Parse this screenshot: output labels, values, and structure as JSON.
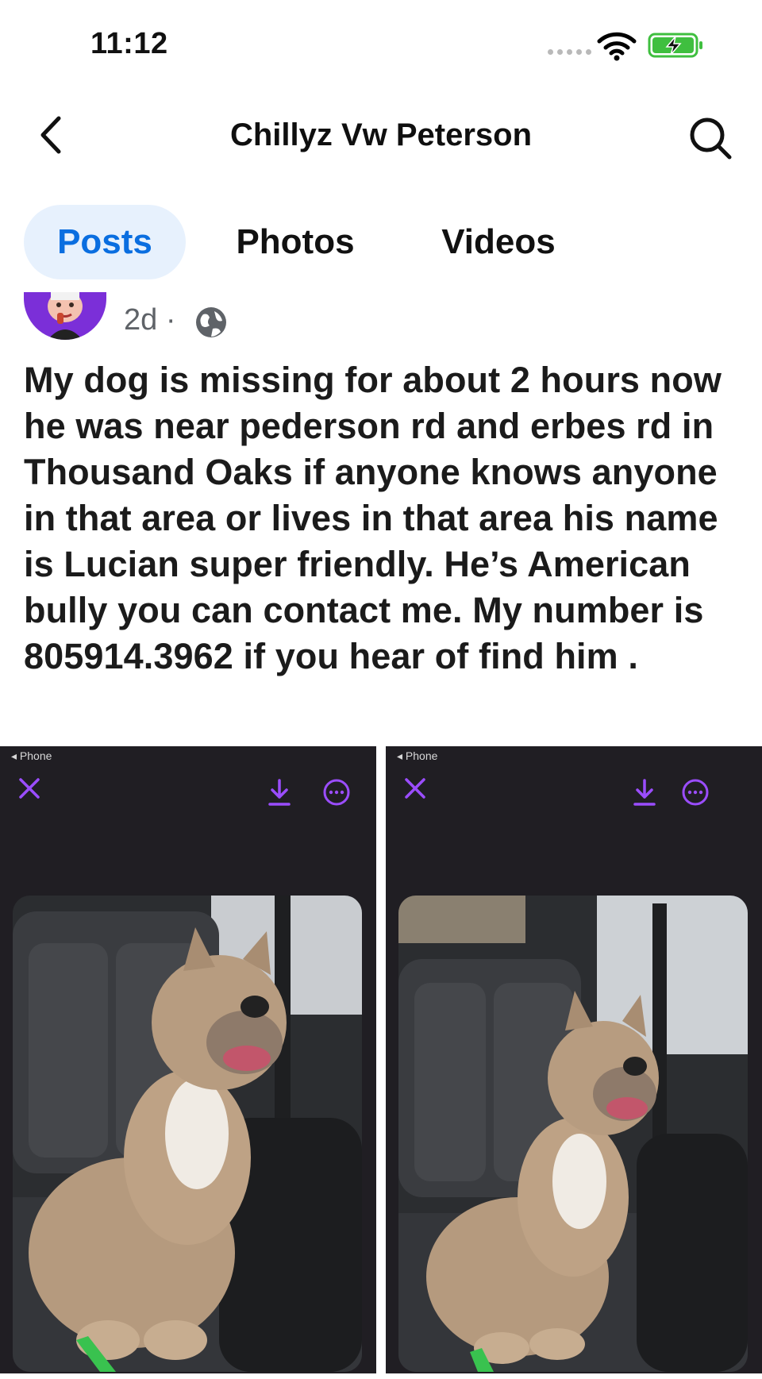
{
  "status_bar": {
    "time": "11:12",
    "icons": [
      "signal-dots-icon",
      "wifi-icon",
      "battery-charging-icon"
    ],
    "battery_color": "#3fbf3f"
  },
  "header": {
    "title": "Chillyz Vw Peterson",
    "back_icon": "chevron-left-icon",
    "search_icon": "search-icon"
  },
  "tabs": [
    {
      "label": "Posts",
      "active": true
    },
    {
      "label": "Photos",
      "active": false
    },
    {
      "label": "Videos",
      "active": false
    }
  ],
  "colors": {
    "accent": "#0a6ee0",
    "active_tab_bg": "#e7f1fd",
    "viewer_icon": "#9b4dff"
  },
  "post": {
    "time": "2d",
    "separator": "·",
    "audience_icon": "globe-icon",
    "text": "My dog is missing for about 2 hours now he was near pederson rd and erbes rd in Thousand Oaks if anyone knows anyone in that area or lives in that area his name is Lucian super friendly. He’s American bully you can contact me. My number is 805914.3962 if you hear of find him .",
    "photos": [
      {
        "back_label": "◂ Phone",
        "icons": [
          "close-icon",
          "download-icon",
          "more-icon"
        ]
      },
      {
        "back_label": "◂ Phone",
        "icons": [
          "close-icon",
          "download-icon",
          "more-icon"
        ]
      }
    ]
  }
}
